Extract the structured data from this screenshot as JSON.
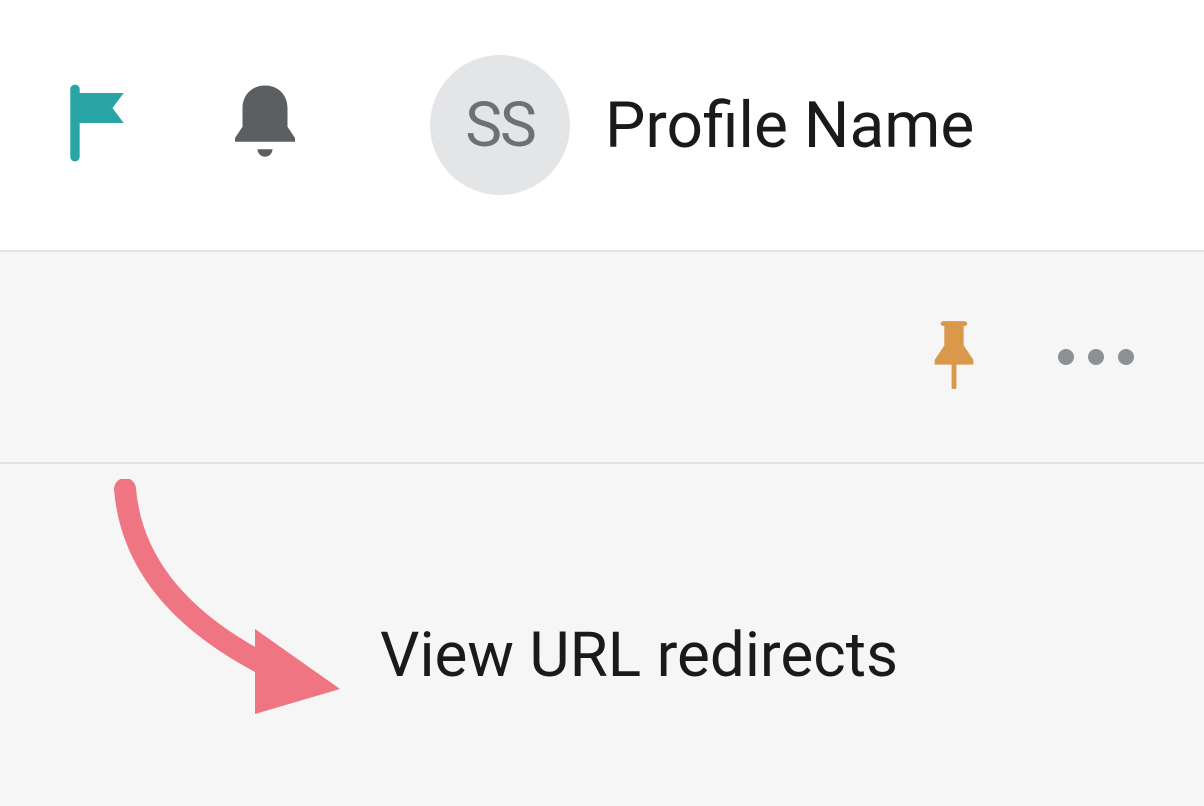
{
  "header": {
    "avatar_initials": "SS",
    "profile_name": "Profile Name"
  },
  "content": {
    "view_redirects_label": "View URL redirects"
  },
  "icons": {
    "flag": "flag-icon",
    "bell": "bell-icon",
    "pin": "pin-icon",
    "more": "more-icon"
  },
  "colors": {
    "flag": "#2aa5a5",
    "bell": "#5c5f62",
    "pin": "#d9984a",
    "arrow": "#f07583",
    "avatar_bg": "#e4e5e7",
    "avatar_text": "#6d7175"
  }
}
